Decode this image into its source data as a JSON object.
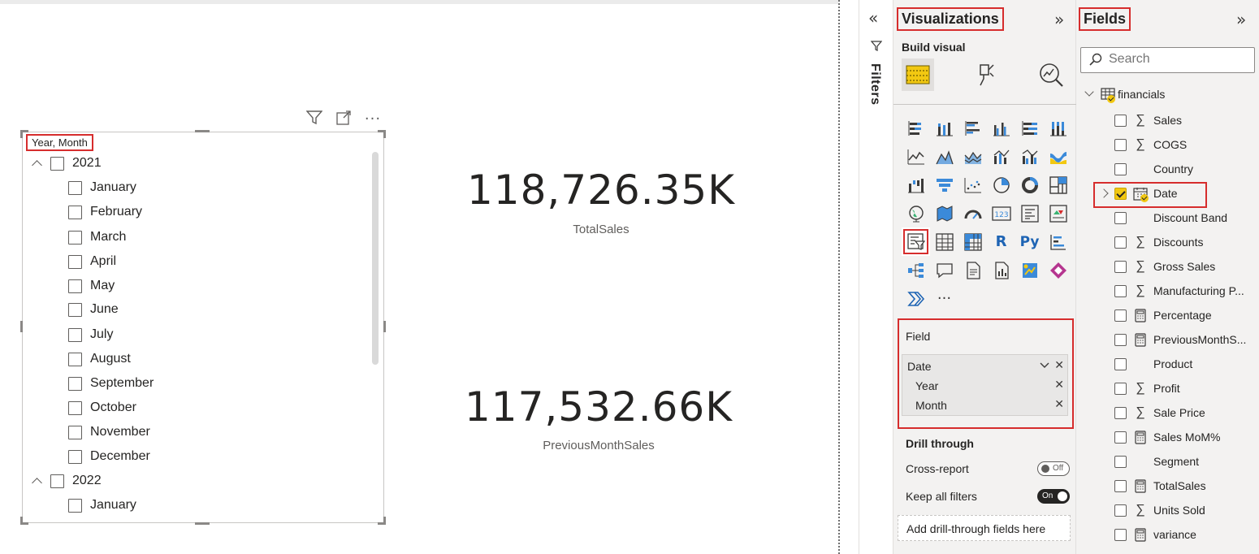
{
  "canvas": {
    "slicer": {
      "title": "Year, Month",
      "years": [
        {
          "label": "2021",
          "months": [
            "January",
            "February",
            "March",
            "April",
            "May",
            "June",
            "July",
            "August",
            "September",
            "October",
            "November",
            "December"
          ]
        },
        {
          "label": "2022",
          "months": [
            "January"
          ]
        }
      ]
    },
    "cards": [
      {
        "value": "118,726.35K",
        "label": "TotalSales"
      },
      {
        "value": "117,532.66K",
        "label": "PreviousMonthSales"
      }
    ],
    "header_icons": [
      "filter-icon",
      "focus-mode-icon",
      "more-options-icon"
    ]
  },
  "filters": {
    "label": "Filters"
  },
  "visualizations": {
    "title": "Visualizations",
    "build_visual": "Build visual",
    "field_well": {
      "label": "Field",
      "items": [
        {
          "label": "Date"
        },
        {
          "label": "Year"
        },
        {
          "label": "Month"
        }
      ]
    },
    "drill_through": {
      "title": "Drill through",
      "cross_report": {
        "label": "Cross-report",
        "state": "Off"
      },
      "keep_filters": {
        "label": "Keep all filters",
        "state": "On"
      },
      "drop_placeholder": "Add drill-through fields here"
    },
    "more": "···"
  },
  "fields": {
    "title": "Fields",
    "search_placeholder": "Search",
    "table": "financials",
    "items": [
      {
        "label": "Sales",
        "type": "sigma",
        "checked": false
      },
      {
        "label": "COGS",
        "type": "sigma",
        "checked": false
      },
      {
        "label": "Country",
        "type": "none",
        "checked": false
      },
      {
        "label": "Date",
        "type": "date",
        "checked": true
      },
      {
        "label": "Discount Band",
        "type": "none",
        "checked": false
      },
      {
        "label": "Discounts",
        "type": "sigma",
        "checked": false
      },
      {
        "label": "Gross Sales",
        "type": "sigma",
        "checked": false
      },
      {
        "label": "Manufacturing P...",
        "type": "sigma",
        "checked": false
      },
      {
        "label": "Percentage",
        "type": "calc",
        "checked": false
      },
      {
        "label": "PreviousMonthS...",
        "type": "calc",
        "checked": false
      },
      {
        "label": "Product",
        "type": "none",
        "checked": false
      },
      {
        "label": "Profit",
        "type": "sigma",
        "checked": false
      },
      {
        "label": "Sale Price",
        "type": "sigma",
        "checked": false
      },
      {
        "label": "Sales MoM%",
        "type": "calc",
        "checked": false
      },
      {
        "label": "Segment",
        "type": "none",
        "checked": false
      },
      {
        "label": "TotalSales",
        "type": "calc",
        "checked": false
      },
      {
        "label": "Units Sold",
        "type": "sigma",
        "checked": false
      },
      {
        "label": "variance",
        "type": "calc",
        "checked": false
      }
    ]
  },
  "colors": {
    "highlight_red": "#d62d2d",
    "accent_yellow": "#f2c811",
    "pane_bg": "#f3f2f1"
  }
}
